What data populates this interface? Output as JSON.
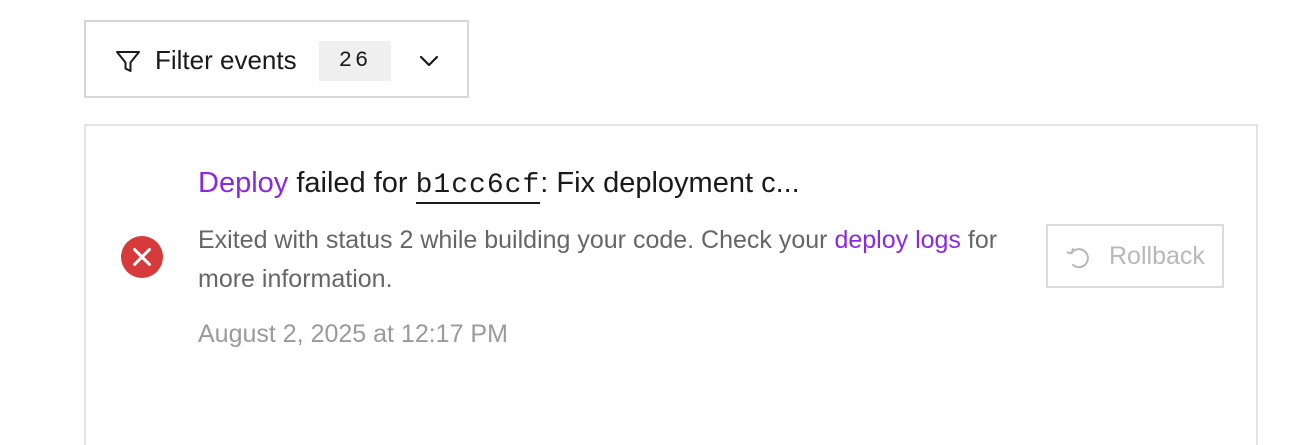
{
  "filter": {
    "label": "Filter events",
    "count": "26",
    "filter_icon": "funnel-icon",
    "chevron_icon": "chevron-down-icon"
  },
  "event": {
    "status": "failed",
    "status_icon": "error-circle-icon",
    "status_color": "#d63a3a",
    "title_type": "Deploy",
    "title_middle": " failed for ",
    "commit": "b1cc6cf",
    "commit_message": ": Fix deployment c...",
    "description_prefix": "Exited with status 2 while building your code. Check your ",
    "description_link": "deploy logs",
    "description_suffix": " for more information.",
    "timestamp": "August 2, 2025 at 12:17 PM",
    "rollback_label": "Rollback",
    "rollback_icon": "rollback-icon"
  },
  "colors": {
    "accent": "#8b28e6",
    "error": "#d63a3a",
    "border": "#e3e3e3",
    "muted_text": "#666666",
    "disabled_text": "#b8b8b8"
  }
}
